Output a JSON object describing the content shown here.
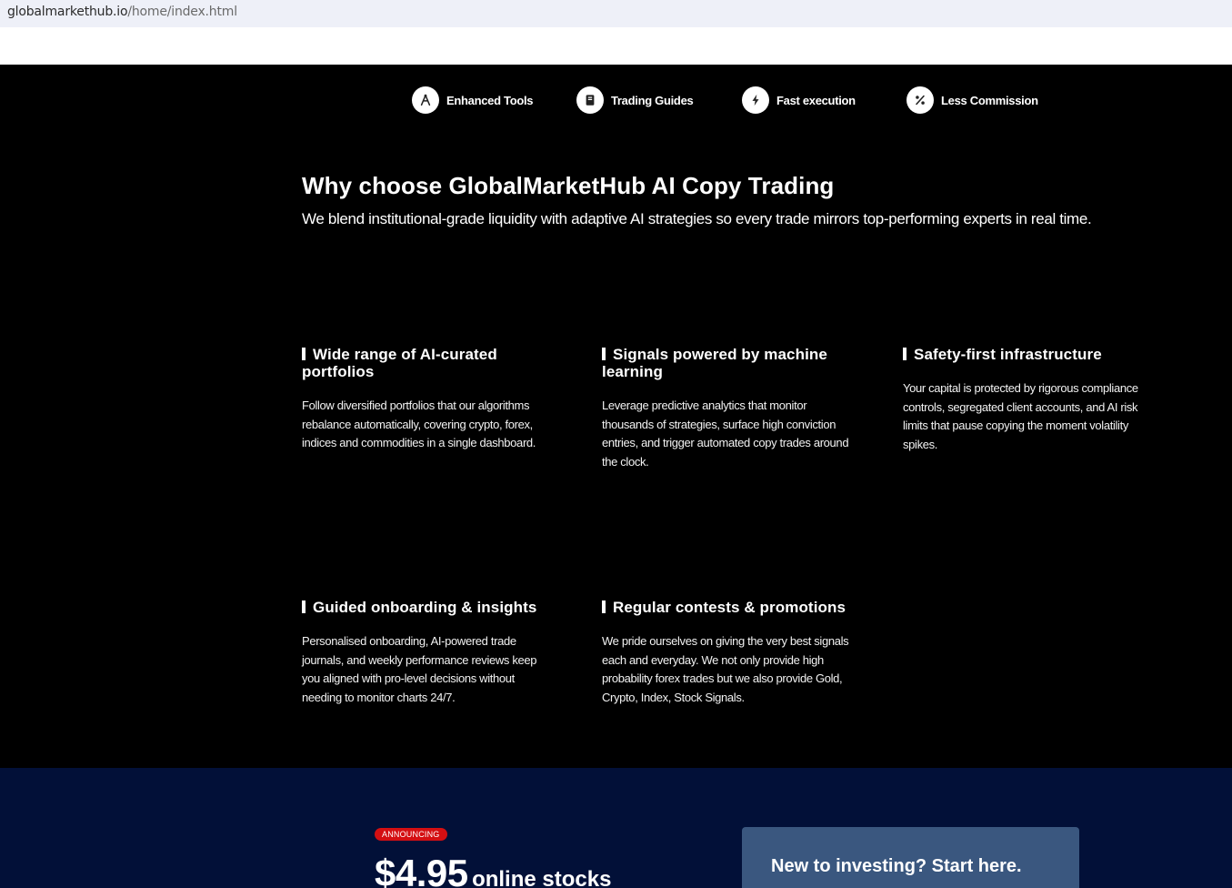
{
  "browser": {
    "url_domain": "globalmarkethub.io",
    "url_path": "/home/index.html"
  },
  "features": [
    {
      "label": "Enhanced Tools",
      "icon": "tools-icon"
    },
    {
      "label": "Trading Guides",
      "icon": "book-icon"
    },
    {
      "label": "Fast execution",
      "icon": "lightning-icon"
    },
    {
      "label": "Less Commission",
      "icon": "percent-icon"
    }
  ],
  "why": {
    "heading": "Why choose GlobalMarketHub AI Copy Trading",
    "subheading": "We blend institutional-grade liquidity with adaptive AI strategies so every trade mirrors top-performing experts in real time."
  },
  "cards": [
    {
      "title": "Wide range of AI-curated portfolios",
      "body": "Follow diversified portfolios that our algorithms rebalance automatically, covering crypto, forex, indices and commodities in a single dashboard."
    },
    {
      "title": "Signals powered by machine learning",
      "body": "Leverage predictive analytics that monitor thousands of strategies, surface high conviction entries, and trigger automated copy trades around the clock."
    },
    {
      "title": "Safety-first infrastructure",
      "body": "Your capital is protected by rigorous compliance controls, segregated client accounts, and AI risk limits that pause copying the moment volatility spikes."
    },
    {
      "title": "Guided onboarding & insights",
      "body": "Personalised onboarding, AI-powered trade journals, and weekly performance reviews keep you aligned with pro-level decisions without needing to monitor charts 24/7."
    },
    {
      "title": "Regular contests & promotions",
      "body": "We pride ourselves on giving the very best signals each and everyday. We not only provide high probability forex trades but we also provide Gold, Crypto, Index, Stock Signals."
    }
  ],
  "promo": {
    "badge": "ANNOUNCING",
    "price": "$4.95",
    "price_suffix": "online stocks",
    "invest_title": "New to investing? Start here."
  },
  "colors": {
    "background": "#000000",
    "navy": "#021038",
    "badge_red": "#d40f12",
    "invest_card": "#3a577f"
  }
}
